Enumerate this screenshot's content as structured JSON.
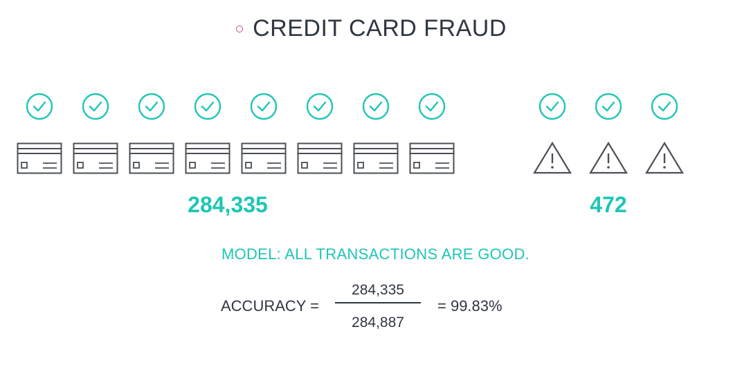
{
  "title": "CREDIT CARD FRAUD",
  "good": {
    "count": "284,335",
    "icon_check": "check-circle-icon",
    "icon_item": "credit-card-icon",
    "shown": 8
  },
  "fraud": {
    "count": "472",
    "icon_check": "check-circle-icon",
    "icon_item": "warning-triangle-icon",
    "shown": 3
  },
  "model_statement": "MODEL: ALL TRANSACTIONS ARE GOOD.",
  "accuracy": {
    "label": "ACCURACY =",
    "numerator": "284,335",
    "denominator": "284,887",
    "result": "= 99.83%"
  },
  "colors": {
    "accent": "#1ec6b4",
    "text": "#2f3640",
    "bullet": "#cc4f86",
    "icon_stroke": "#4a4f55"
  }
}
